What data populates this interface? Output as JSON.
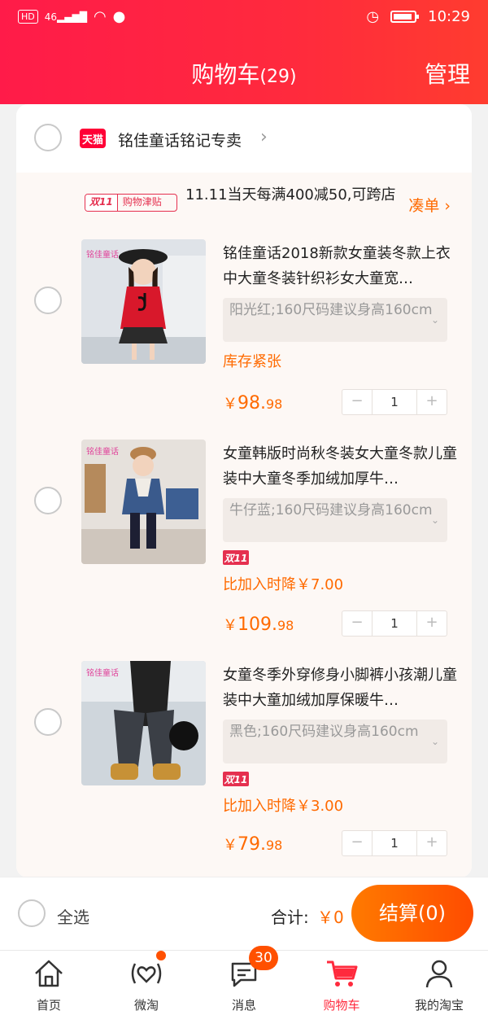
{
  "status_bar": {
    "left_chip1": "HD",
    "signal": "46",
    "time": "10:29"
  },
  "header": {
    "title": "购物车",
    "count": "(29)",
    "manage": "管理"
  },
  "store": {
    "badge": "天猫",
    "name": "铭佳童话铭记专卖",
    "arrow": "›"
  },
  "promo": {
    "tag_a": "双11",
    "tag_b": "购物津贴",
    "text": "11.11当天每满400减50,可跨店",
    "link": "凑单 ›"
  },
  "items": [
    {
      "title": "铭佳童话2018新款女童装冬款上衣中大童冬装针织衫女大童宽…",
      "sku": "阳光红;160尺码建议身高160cm",
      "note": "库存紧张",
      "price_sym": "￥",
      "price_int": "98.",
      "price_dec": "98",
      "qty": "1",
      "thumb_brand": "铭佳童话"
    },
    {
      "title": "女童韩版时尚秋冬装女大童冬款儿童装中大童冬季加绒加厚牛…",
      "sku": "牛仔蓝;160尺码建议身高160cm",
      "badge": "双11",
      "drop": "比加入时降￥7.00",
      "price_sym": "￥",
      "price_int": "109.",
      "price_dec": "98",
      "qty": "1",
      "thumb_brand": "铭佳童话"
    },
    {
      "title": "女童冬季外穿修身小脚裤小孩潮儿童装中大童加绒加厚保暖牛…",
      "sku": "黑色;160尺码建议身高160cm",
      "badge": "双11",
      "drop": "比加入时降￥3.00",
      "price_sym": "￥",
      "price_int": "79.",
      "price_dec": "98",
      "qty": "1",
      "thumb_brand": "铭佳童话"
    }
  ],
  "stepper": {
    "minus": "−",
    "plus": "+"
  },
  "checkout": {
    "select_all": "全选",
    "total_label": "合计:",
    "total_value": "￥0",
    "pay": "结算(0)"
  },
  "tabs": [
    {
      "label": "首页",
      "icon": "home-icon"
    },
    {
      "label": "微淘",
      "icon": "heart-wave-icon"
    },
    {
      "label": "消息",
      "icon": "message-icon",
      "badge": "30"
    },
    {
      "label": "购物车",
      "icon": "cart-icon"
    },
    {
      "label": "我的淘宝",
      "icon": "user-icon"
    }
  ],
  "colors": {
    "accent": "#ff2a3d",
    "orange": "#ff6a00",
    "tmall": "#ff0036"
  }
}
